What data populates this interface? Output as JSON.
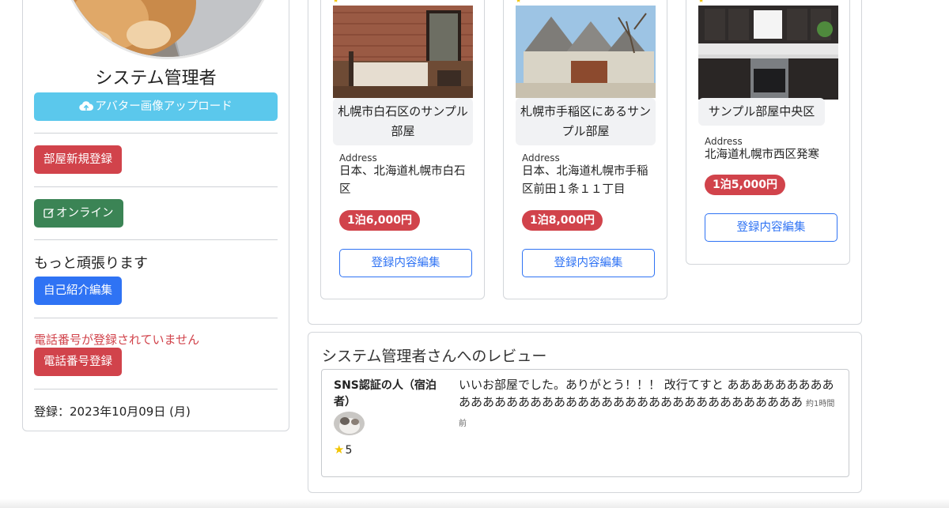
{
  "profile": {
    "name": "システム管理者",
    "upload_button": "アバター画像アップロード",
    "register_room_button": "部屋新規登録",
    "online_button": "オンライン",
    "motto": "もっと頑張ります",
    "edit_intro_button": "自己紹介編集",
    "phone_warning": "電話番号が登録されていません",
    "register_phone_button": "電話番号登録",
    "registered_date": "登録：2023年10月09日 (月)"
  },
  "rooms": [
    {
      "title": "札幌市白石区のサンプル部屋",
      "address_label": "Address",
      "address": "日本、北海道札幌市白石区",
      "price": "1泊6,000円",
      "edit_button": "登録内容編集"
    },
    {
      "title": "札幌市手稲区にあるサンプル部屋",
      "address_label": "Address",
      "address": "日本、北海道札幌市手稲区前田１条１１丁目",
      "price": "1泊8,000円",
      "edit_button": "登録内容編集"
    },
    {
      "title": "サンプル部屋中央区",
      "address_label": "Address",
      "address": "北海道札幌市西区発寒",
      "price": "1泊5,000円",
      "edit_button": "登録内容編集"
    }
  ],
  "reviews_section": {
    "title": "システム管理者さんへのレビュー",
    "items": [
      {
        "reviewer": "SNS認証の人（宿泊者）",
        "rating": "5",
        "text": "いいお部屋でした。ありがとう！！！ 改行てすと ああああああああああああああああああああああああああああああああああああああ",
        "time": "約1時間前"
      }
    ]
  },
  "colors": {
    "upload": "#5bc8ec",
    "danger": "#d1434b",
    "success": "#3b8455",
    "primary": "#2f73f4"
  },
  "icons": {
    "upload": "cloud-upload-icon",
    "online": "pencil-square-icon",
    "rating": "star-icon"
  }
}
